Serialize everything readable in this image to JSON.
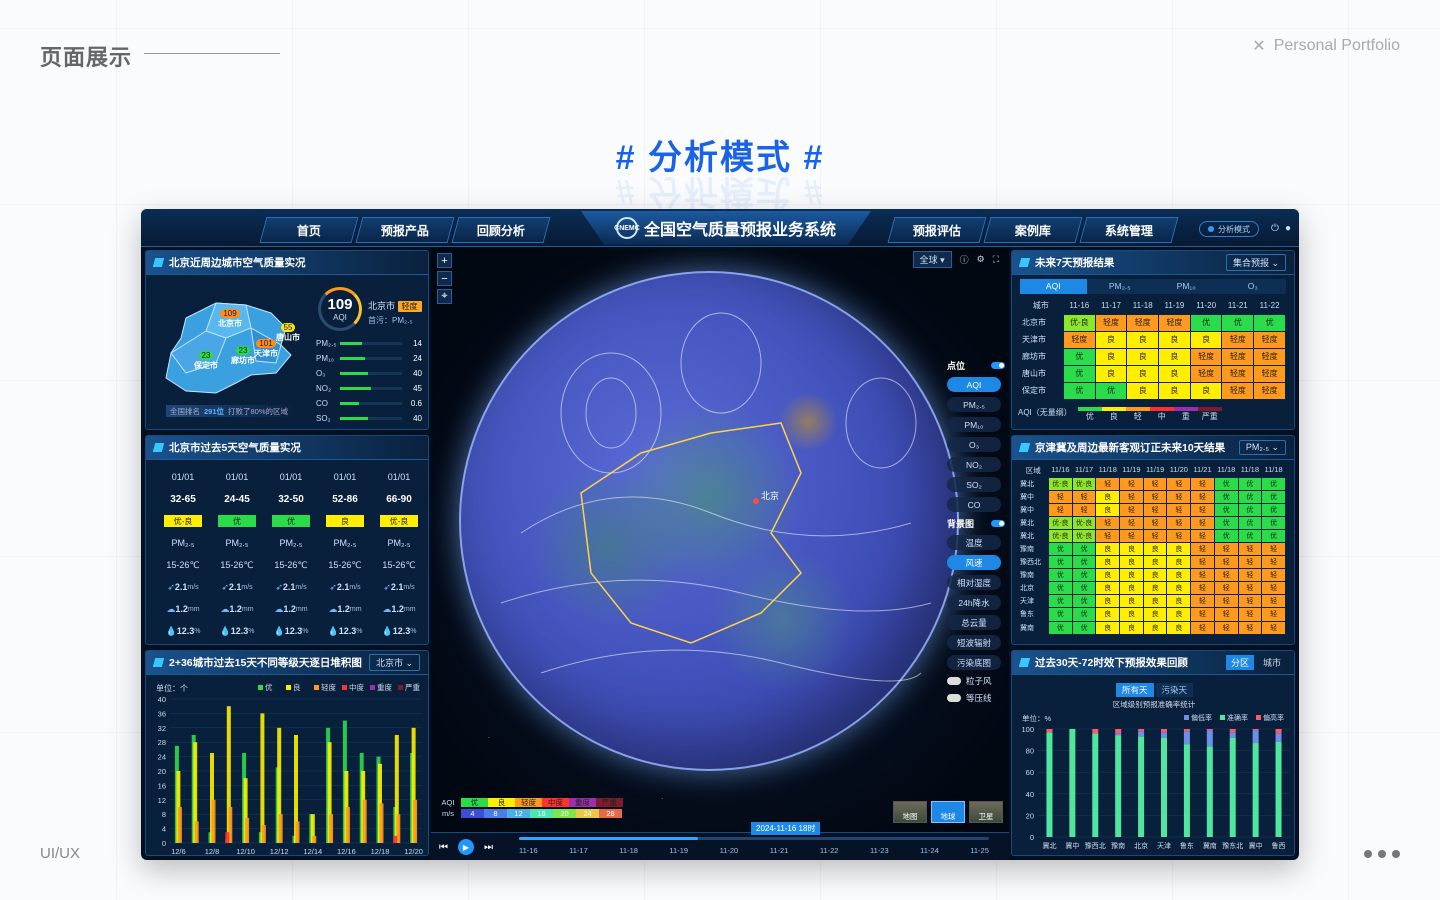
{
  "page": {
    "section_title": "页面展示",
    "portfolio_label": "Personal Portfolio",
    "hero_title": "# 分析模式 #",
    "footer_label": "UI/UX"
  },
  "app": {
    "title": "全国空气质量预报业务系统",
    "logo_text": "CNEMC",
    "nav_left": [
      "首页",
      "预报产品",
      "回顾分析"
    ],
    "nav_right": [
      "预报评估",
      "案例库",
      "系统管理"
    ],
    "mode_label": "分析模式"
  },
  "panel_city": {
    "title": "北京近周边城市空气质量实况",
    "map_cities": [
      {
        "name": "北京市",
        "aqi": "109",
        "color": "#ff8c1a"
      },
      {
        "name": "唐山市",
        "aqi": "55",
        "color": "#ffe21a"
      },
      {
        "name": "天津市",
        "aqi": "101",
        "color": "#ff8c1a"
      },
      {
        "name": "廊坊市",
        "aqi": "23",
        "color": "#2adb4a"
      },
      {
        "name": "保定市",
        "aqi": "23",
        "color": "#2adb4a"
      }
    ],
    "aqi_value": "109",
    "aqi_label": "AQI",
    "city": "北京市",
    "level": "轻度",
    "primary": "首污：PM₂.₅",
    "pollutants": [
      {
        "name": "PM₂.₅",
        "value": "14",
        "pct": 0.35
      },
      {
        "name": "PM₁₀",
        "value": "24",
        "pct": 0.4
      },
      {
        "name": "O₃",
        "value": "40",
        "pct": 0.45
      },
      {
        "name": "NO₂",
        "value": "45",
        "pct": 0.5
      },
      {
        "name": "CO",
        "value": "0.6",
        "pct": 0.3
      },
      {
        "name": "SO₂",
        "value": "40",
        "pct": 0.45
      }
    ],
    "rank_prefix": "全国排名",
    "rank_value": "291位",
    "rank_suffix": "打败了80%的区域"
  },
  "panel_5day": {
    "title": "北京市过去5天空气质量实况",
    "days": [
      {
        "date": "01/01",
        "range": "32-65",
        "level": "优-良",
        "level_color": "#ffee00",
        "pol": "PM₂.₅",
        "temp": "15-26℃",
        "wind": "2.1",
        "rain": "1.2",
        "hum": "12.3"
      },
      {
        "date": "01/01",
        "range": "24-45",
        "level": "优",
        "level_color": "#2adb4a",
        "pol": "PM₂.₅",
        "temp": "15-26℃",
        "wind": "2.1",
        "rain": "1.2",
        "hum": "12.3"
      },
      {
        "date": "01/01",
        "range": "32-50",
        "level": "优",
        "level_color": "#2adb4a",
        "pol": "PM₂.₅",
        "temp": "15-26℃",
        "wind": "2.1",
        "rain": "1.2",
        "hum": "12.3"
      },
      {
        "date": "01/01",
        "range": "52-86",
        "level": "良",
        "level_color": "#ffee00",
        "pol": "PM₂.₅",
        "temp": "15-26℃",
        "wind": "2.1",
        "rain": "1.2",
        "hum": "12.3"
      },
      {
        "date": "01/01",
        "range": "66-90",
        "level": "优-良",
        "level_color": "#ffee00",
        "pol": "PM₂.₅",
        "temp": "15-26℃",
        "wind": "2.1",
        "rain": "1.2",
        "hum": "12.3"
      }
    ],
    "wind_unit": "m/s",
    "rain_unit": "mm",
    "hum_unit": "%"
  },
  "panel_stack": {
    "title": "2+36城市过去15天不同等级天逐日堆积图",
    "selector": "北京市",
    "unit": "单位：个",
    "legend": [
      {
        "name": "优",
        "color": "#2adb4a"
      },
      {
        "name": "良",
        "color": "#ffee00"
      },
      {
        "name": "轻度",
        "color": "#ff9a1e"
      },
      {
        "name": "中度",
        "color": "#ff3030"
      },
      {
        "name": "重度",
        "color": "#9b2fae"
      },
      {
        "name": "严重",
        "color": "#7e1b2c"
      }
    ]
  },
  "chart_data": [
    {
      "type": "bar",
      "title": "2+36城市过去15天不同等级天逐日堆积图",
      "ylabel": "单位：个",
      "ylim": [
        0,
        40
      ],
      "yticks": [
        0,
        4,
        8,
        12,
        16,
        20,
        24,
        28,
        32,
        36,
        40
      ],
      "categories": [
        "12/6",
        "12/7",
        "12/8",
        "12/9",
        "12/10",
        "12/11",
        "12/12",
        "12/13",
        "12/14",
        "12/15",
        "12/16",
        "12/17",
        "12/18",
        "12/19",
        "12/20"
      ],
      "xticks": [
        "12/6",
        "12/8",
        "12/10",
        "12/12",
        "12/14",
        "12/16",
        "12/18",
        "12/20"
      ],
      "series": [
        {
          "name": "优",
          "values": [
            27,
            30,
            3,
            1,
            25,
            3,
            21,
            2,
            8,
            32,
            34,
            25,
            24,
            10,
            25
          ]
        },
        {
          "name": "良",
          "values": [
            20,
            28,
            25,
            38,
            18,
            36,
            32,
            30,
            8,
            28,
            20,
            20,
            22,
            30,
            32
          ]
        },
        {
          "name": "轻度",
          "values": [
            10,
            6,
            12,
            10,
            7,
            5,
            8,
            6,
            2,
            8,
            10,
            12,
            11,
            8,
            12
          ]
        },
        {
          "name": "中度",
          "values": [
            0,
            0,
            0,
            3,
            0,
            0,
            0,
            0,
            0,
            0,
            0,
            0,
            0,
            2,
            0
          ]
        },
        {
          "name": "重度",
          "values": [
            0,
            0,
            0,
            0,
            0,
            0,
            0,
            0,
            0,
            0,
            0,
            0,
            0,
            0,
            0
          ]
        },
        {
          "name": "严重",
          "values": [
            0,
            0,
            0,
            0,
            0,
            0,
            0,
            0,
            0,
            0,
            0,
            0,
            0,
            0,
            0
          ]
        }
      ]
    },
    {
      "type": "bar",
      "title": "区域级别预报准确率统计",
      "ylabel": "单位：%",
      "ylim": [
        0,
        100
      ],
      "yticks": [
        0,
        20,
        40,
        60,
        80,
        100
      ],
      "categories": [
        "冀北",
        "冀中",
        "豫西北",
        "豫南",
        "北京",
        "天津",
        "鲁东",
        "冀南",
        "豫东北",
        "冀中",
        "鲁西"
      ],
      "series": [
        {
          "name": "偏低率",
          "values": [
            0,
            0,
            0,
            2,
            5,
            5,
            12,
            15,
            5,
            12,
            8
          ]
        },
        {
          "name": "准确率",
          "values": [
            97,
            100,
            96,
            94,
            93,
            92,
            86,
            84,
            92,
            87,
            88
          ]
        },
        {
          "name": "偏高率",
          "values": [
            3,
            0,
            4,
            4,
            2,
            3,
            2,
            1,
            3,
            1,
            4
          ]
        }
      ]
    }
  ],
  "globe": {
    "scope": "全球",
    "points_label": "点位",
    "point_layers": [
      "AQI",
      "PM₂.₅",
      "PM₁₀",
      "O₃",
      "NO₂",
      "SO₂",
      "CO"
    ],
    "bg_label": "背景图",
    "bg_layers": [
      "温度",
      "风速",
      "相对湿度",
      "24h降水",
      "总云量",
      "短波辐射",
      "污染底图"
    ],
    "toggles": [
      "粒子风",
      "等压线"
    ],
    "aqi_legend_label": "AQI",
    "aqi_legend": [
      {
        "name": "优",
        "color": "#2adb4a"
      },
      {
        "name": "良",
        "color": "#ffee00"
      },
      {
        "name": "轻度",
        "color": "#ff9a1e"
      },
      {
        "name": "中度",
        "color": "#ff3030"
      },
      {
        "name": "重度",
        "color": "#9b2fae"
      },
      {
        "name": "严重",
        "color": "#7e1b2c"
      }
    ],
    "wind_legend_label": "m/s",
    "wind_legend": [
      "4",
      "8",
      "12",
      "16",
      "20",
      "24",
      "28"
    ],
    "basemaps": [
      {
        "name": "地图",
        "on": false
      },
      {
        "name": "地球",
        "on": true
      },
      {
        "name": "卫星",
        "on": false
      }
    ],
    "time_now": "2024-11-16 18时",
    "timeline": [
      "11-16",
      "11-17",
      "11-18",
      "11-19",
      "11-20",
      "11-21",
      "11-22",
      "11-23",
      "11-24",
      "11-25"
    ],
    "timeline_progress": 0.38,
    "city_marker": "北京"
  },
  "panel_7day": {
    "title": "未来7天预报结果",
    "selector": "集合预报",
    "tabs": [
      "AQI",
      "PM₂.₅",
      "PM₁₀",
      "O₃"
    ],
    "headers": [
      "城市",
      "11-16",
      "11-17",
      "11-18",
      "11-19",
      "11-20",
      "11-21",
      "11-22"
    ],
    "rows": [
      {
        "city": "北京市",
        "cells": [
          "优-良",
          "轻度",
          "轻度",
          "轻度",
          "优",
          "优",
          "优"
        ]
      },
      {
        "city": "天津市",
        "cells": [
          "轻度",
          "良",
          "良",
          "良",
          "良",
          "轻度",
          "轻度"
        ]
      },
      {
        "city": "廊坊市",
        "cells": [
          "优",
          "良",
          "良",
          "良",
          "轻度",
          "轻度",
          "轻度"
        ]
      },
      {
        "city": "唐山市",
        "cells": [
          "优",
          "良",
          "良",
          "良",
          "轻度",
          "轻度",
          "轻度"
        ]
      },
      {
        "city": "保定市",
        "cells": [
          "优",
          "优",
          "良",
          "良",
          "良",
          "轻度",
          "轻度"
        ]
      }
    ],
    "scale_label": "AQI（无量纲）",
    "scale_levels": [
      "优",
      "良",
      "轻",
      "中",
      "重",
      "严重"
    ]
  },
  "panel_10day": {
    "title": "京津冀及周边最新客观订正未来10天结果",
    "selector": "PM₂.₅",
    "headers": [
      "区域",
      "11/16",
      "11/17",
      "11/18",
      "11/19",
      "11/19",
      "11/20",
      "11/21",
      "11/18",
      "11/18",
      "11/18"
    ],
    "rows": [
      {
        "city": "冀北",
        "cells": [
          "优-良",
          "优-良",
          "轻",
          "轻",
          "轻",
          "轻",
          "轻",
          "优",
          "优",
          "优"
        ]
      },
      {
        "city": "冀中",
        "cells": [
          "轻",
          "轻",
          "良",
          "轻",
          "轻",
          "轻",
          "轻",
          "优",
          "优",
          "优"
        ]
      },
      {
        "city": "冀中",
        "cells": [
          "轻",
          "轻",
          "良",
          "轻",
          "轻",
          "轻",
          "轻",
          "优",
          "优",
          "优"
        ]
      },
      {
        "city": "冀北",
        "cells": [
          "优-良",
          "优-良",
          "轻",
          "轻",
          "轻",
          "轻",
          "轻",
          "优",
          "优",
          "优"
        ]
      },
      {
        "city": "冀北",
        "cells": [
          "优-良",
          "优-良",
          "轻",
          "轻",
          "轻",
          "轻",
          "轻",
          "优",
          "优",
          "优"
        ]
      },
      {
        "city": "豫南",
        "cells": [
          "优",
          "优",
          "良",
          "良",
          "良",
          "良",
          "轻",
          "轻",
          "轻",
          "轻"
        ]
      },
      {
        "city": "豫西北",
        "cells": [
          "优",
          "优",
          "良",
          "良",
          "良",
          "良",
          "轻",
          "轻",
          "轻",
          "轻"
        ]
      },
      {
        "city": "豫南",
        "cells": [
          "优",
          "优",
          "良",
          "良",
          "良",
          "良",
          "轻",
          "轻",
          "轻",
          "轻"
        ]
      },
      {
        "city": "北京",
        "cells": [
          "优",
          "优",
          "良",
          "良",
          "良",
          "良",
          "轻",
          "轻",
          "轻",
          "轻"
        ]
      },
      {
        "city": "天津",
        "cells": [
          "优",
          "优",
          "良",
          "良",
          "良",
          "良",
          "轻",
          "轻",
          "轻",
          "轻"
        ]
      },
      {
        "city": "鲁东",
        "cells": [
          "优",
          "优",
          "良",
          "良",
          "良",
          "良",
          "轻",
          "轻",
          "轻",
          "轻"
        ]
      },
      {
        "city": "冀南",
        "cells": [
          "优",
          "优",
          "良",
          "良",
          "良",
          "良",
          "轻",
          "轻",
          "轻",
          "轻"
        ]
      }
    ]
  },
  "panel_acc": {
    "title": "过去30天-72时效下预报效果回顾",
    "sub_tabs": [
      "分区",
      "城市"
    ],
    "tabs": [
      "所有天",
      "污染天"
    ],
    "chart_title": "区域级别预报准确率统计",
    "unit": "单位：%",
    "legend": [
      {
        "name": "偏低率",
        "color": "#6f8fe6"
      },
      {
        "name": "准确率",
        "color": "#4fe6a0"
      },
      {
        "name": "偏高率",
        "color": "#ff5a6a"
      }
    ]
  }
}
